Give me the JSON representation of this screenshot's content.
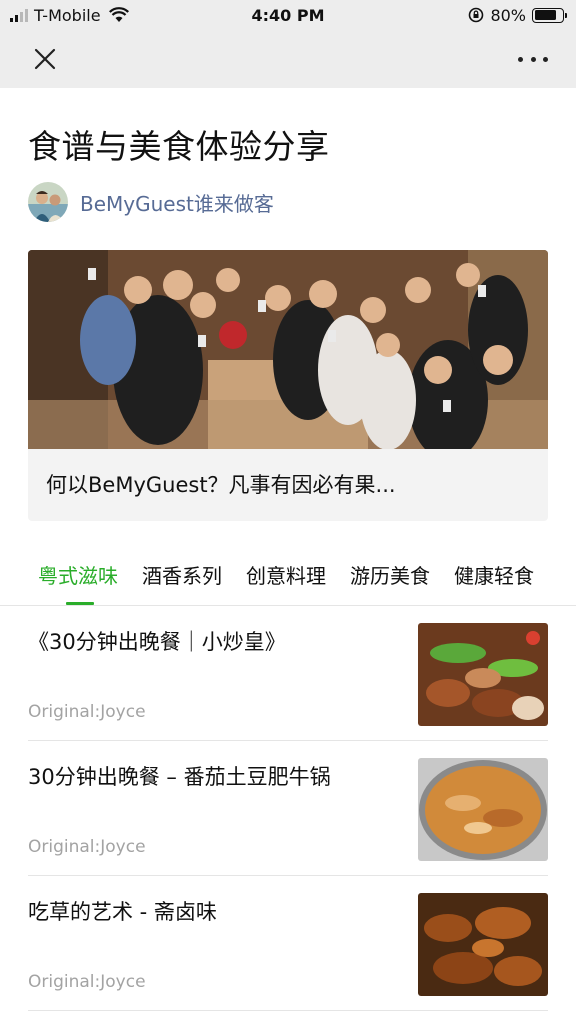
{
  "status_bar": {
    "carrier": "T-Mobile",
    "time": "4:40 PM",
    "battery": "80%",
    "battery_level": 0.8,
    "icons": [
      "signal-icon",
      "wifi-icon",
      "rotation-lock-icon",
      "battery-icon"
    ]
  },
  "nav": {
    "close_icon": "close-icon",
    "more_icon": "more-icon"
  },
  "header": {
    "title": "食谱与美食体验分享",
    "author": "BeMyGuest谁来做客"
  },
  "banner": {
    "caption": "何以BeMyGuest？凡事有因必有果..."
  },
  "tabs": [
    {
      "label": "粤式滋味",
      "active": true
    },
    {
      "label": "酒香系列",
      "active": false
    },
    {
      "label": "创意料理",
      "active": false
    },
    {
      "label": "游历美食",
      "active": false
    },
    {
      "label": "健康轻食",
      "active": false
    }
  ],
  "articles": [
    {
      "title": "《30分钟出晚餐｜小炒皇》",
      "meta": "Original:Joyce"
    },
    {
      "title": "30分钟出晚餐 – 番茄土豆肥牛锅",
      "meta": "Original:Joyce"
    },
    {
      "title": "吃草的艺术 - 斋卤味",
      "meta": "Original:Joyce"
    }
  ],
  "colors": {
    "accent": "#2aad2a",
    "link": "#576b95",
    "meta": "#a3a3a3",
    "bar_bg": "#ededed"
  }
}
